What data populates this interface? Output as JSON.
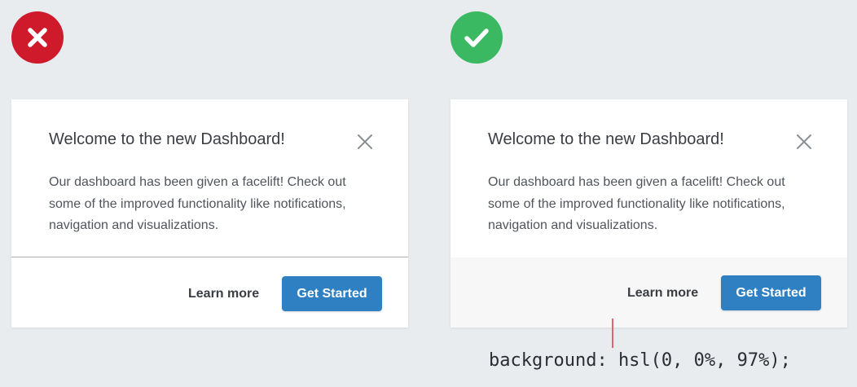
{
  "examples": {
    "bad": {
      "indicator_icon": "x-icon",
      "indicator_color": "#cf1a2b",
      "footer_separator": "border line",
      "modal": {
        "title": "Welcome to the new Dashboard!",
        "body_lines": [
          "Our dashboard has been given a facelift! Check out",
          "some of the improved functionality like notifications,",
          "navigation and visualizations."
        ],
        "close_icon": "close-icon",
        "secondary_action": "Learn more",
        "primary_action": "Get Started"
      }
    },
    "good": {
      "indicator_icon": "check-icon",
      "indicator_color": "#3bb862",
      "footer_separator": "background shade",
      "footer_background": "#f7f7f7",
      "modal": {
        "title": "Welcome to the new Dashboard!",
        "body_lines": [
          "Our dashboard has been given a facelift! Check out",
          "some of the improved functionality like notifications,",
          "navigation and visualizations."
        ],
        "close_icon": "close-icon",
        "secondary_action": "Learn more",
        "primary_action": "Get Started"
      }
    }
  },
  "annotation": {
    "css_code": "background: hsl(0, 0%, 97%);",
    "pointer_color": "#e8636e"
  },
  "colors": {
    "page_background": "#e8ecef",
    "primary_button": "#2e80c3",
    "title_text": "#3a3e44"
  }
}
